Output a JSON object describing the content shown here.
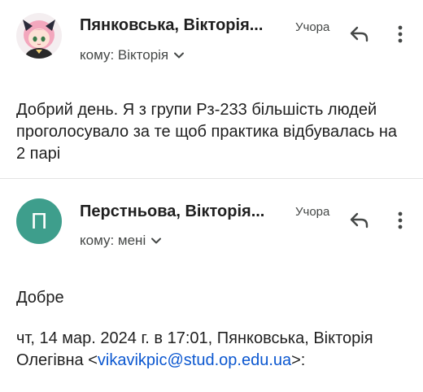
{
  "messages": [
    {
      "sender": "Пянковська, Вікторія...",
      "time": "Учора",
      "recipient": "кому: Вікторія",
      "body": "Добрий день. Я з групи Рз-233 більшість людей проголосувало за те щоб практика відбувалась на 2 парі"
    },
    {
      "sender": "Перстньова, Вікторія...",
      "avatar_letter": "П",
      "time": "Учора",
      "recipient": "кому: мені",
      "body": "Добре",
      "quote_header_prefix": "чт, 14 мар. 2024 г. в 17:01, Пянковська, Вікторія Олегівна <",
      "quote_email": "vikavikpic@stud.op.edu.ua",
      "quote_header_suffix": ">:"
    }
  ],
  "colors": {
    "avatar_bg": "#3e9e8c",
    "link": "#0b57d0",
    "divider": "#e3e3e3"
  },
  "icons": {
    "reply": "reply-icon",
    "more": "more-vert-icon",
    "expand": "chevron-down-icon"
  }
}
